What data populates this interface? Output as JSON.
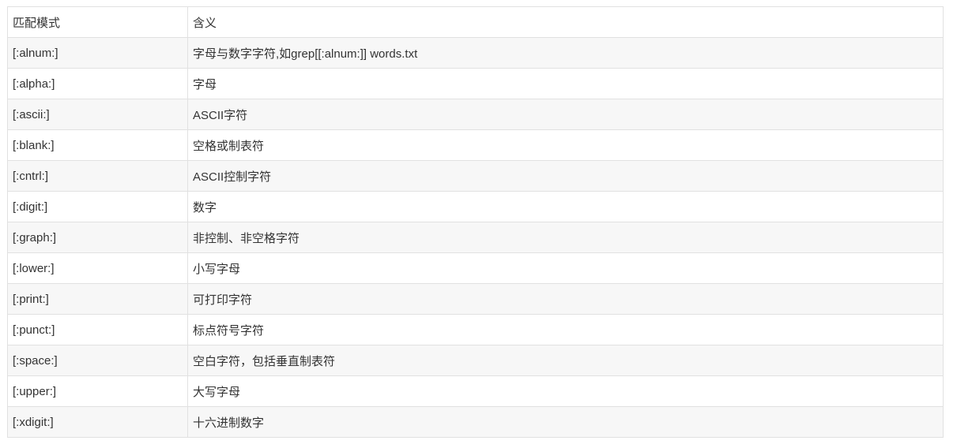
{
  "table": {
    "headers": [
      "匹配模式",
      "含义"
    ],
    "rows": [
      [
        "[:alnum:]",
        "字母与数字字符,如grep[[:alnum:]] words.txt"
      ],
      [
        "[:alpha:]",
        "字母"
      ],
      [
        "[:ascii:]",
        "ASCII字符"
      ],
      [
        "[:blank:]",
        "空格或制表符"
      ],
      [
        "[:cntrl:]",
        "ASCII控制字符"
      ],
      [
        "[:digit:]",
        "数字"
      ],
      [
        "[:graph:]",
        "非控制、非空格字符"
      ],
      [
        "[:lower:]",
        "小写字母"
      ],
      [
        "[:print:]",
        "可打印字符"
      ],
      [
        "[:punct:]",
        "标点符号字符"
      ],
      [
        "[:space:]",
        "空白字符，包括垂直制表符"
      ],
      [
        "[:upper:]",
        "大写字母"
      ],
      [
        "[:xdigit:]",
        "十六进制数字"
      ]
    ]
  }
}
